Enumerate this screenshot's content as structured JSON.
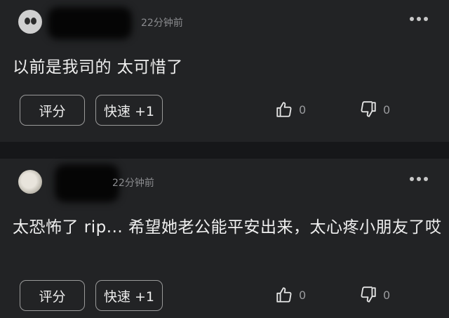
{
  "comments": [
    {
      "time": "22分钟前",
      "text": "以前是我司的 太可惜了",
      "rate_label": "评分",
      "quick_label": "快速 +1",
      "likes": "0",
      "dislikes": "0"
    },
    {
      "time": "22分钟前",
      "text": "太恐怖了 rip... 希望她老公能平安出来，太心疼小朋友了哎",
      "rate_label": "评分",
      "quick_label": "快速 +1",
      "likes": "0",
      "dislikes": "0"
    }
  ],
  "icons": {
    "more": "more-dots-icon",
    "like": "thumbs-up-icon",
    "dislike": "thumbs-down-icon"
  }
}
